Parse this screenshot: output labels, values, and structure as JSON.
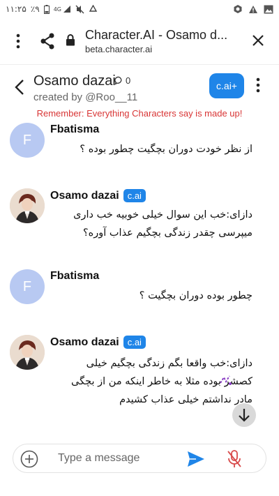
{
  "status": {
    "time": "۱۱:۲۵",
    "battery": "٪۹",
    "network": "4G",
    "icons": [
      "battery-icon",
      "signal-icon",
      "mute-icon",
      "recycle-icon",
      "app-icon",
      "warning-icon",
      "image-icon"
    ]
  },
  "browser": {
    "title": "Character.AI - Osamo d...",
    "url": "beta.character.ai"
  },
  "chat_header": {
    "character_name": "Osamo dazai",
    "chat_count": "0",
    "creator": "created by @Roo__11",
    "plus_label": "c.ai+",
    "disclaimer": "Remember: Everything Characters say is made up!"
  },
  "messages": [
    {
      "sender": "Fbatisma",
      "avatar_letter": "F",
      "is_bot": false,
      "text": "از نظر خودت دوران بچگیت چطور بوده ؟"
    },
    {
      "sender": "Osamo dazai",
      "badge": "c.ai",
      "is_bot": true,
      "text": "دازای:خب این سوال خیلی خوبیه خب داری\nمیپرسی چقدر زندگی بچگیم عذاب آوره؟"
    },
    {
      "sender": "Fbatisma",
      "avatar_letter": "F",
      "is_bot": false,
      "text": "چطور بوده دوران بچگیت ؟"
    },
    {
      "sender": "Osamo dazai",
      "badge": "c.ai",
      "is_bot": true,
      "text": "دازای:خب واقعا بگم زندگی بچگیم خیلی\nکصشر بوده مثلا به خاطر اینکه من از بچگی\nمادر نداشتم خیلی عذاب کشیدم"
    }
  ],
  "composer": {
    "placeholder": "Type a message"
  },
  "colors": {
    "accent": "#1f85e8",
    "avatar_letter_bg": "#b8c9f2",
    "disclaimer": "#d83535",
    "send": "#1f85e8",
    "mic_muted": "#d84a4a"
  }
}
